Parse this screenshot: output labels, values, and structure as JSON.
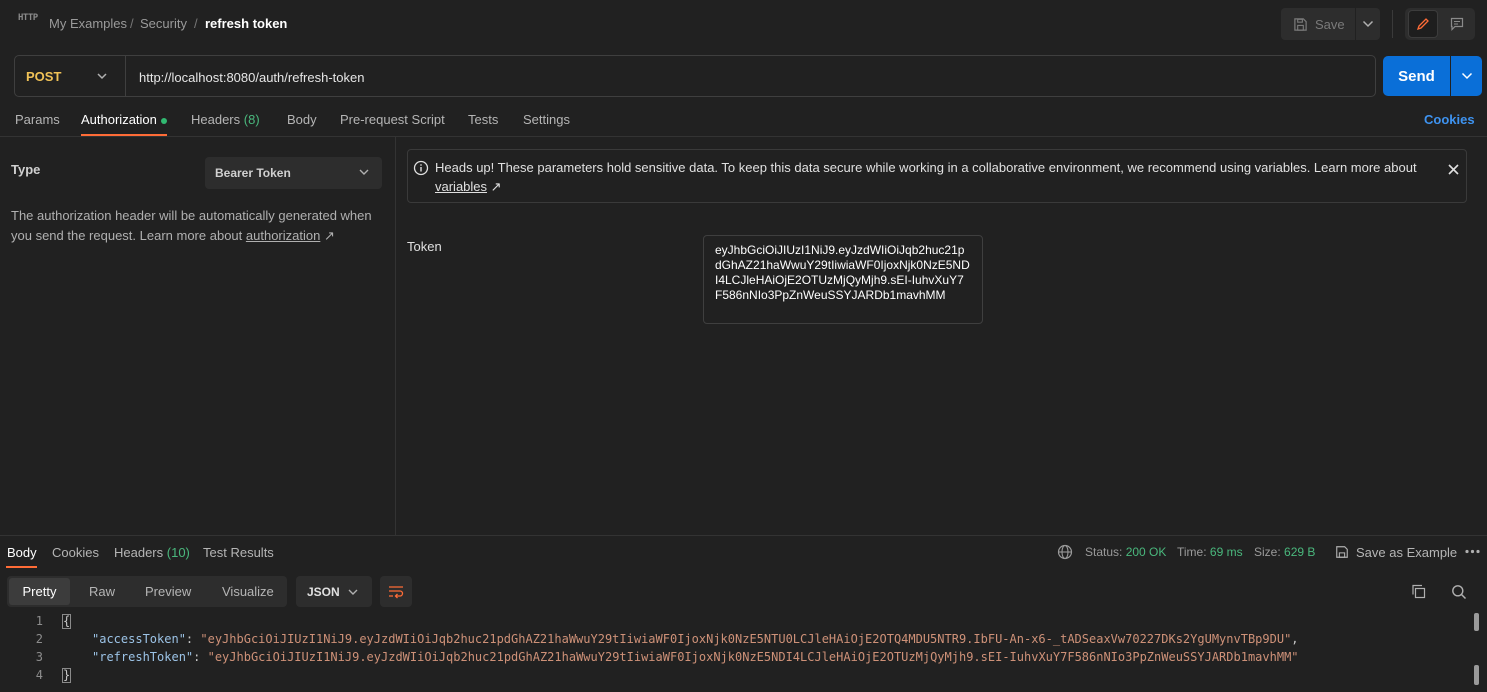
{
  "header": {
    "app_icon_text": "HTTP",
    "breadcrumb": [
      "My Examples",
      "Security",
      "refresh token"
    ],
    "breadcrumb_sep": "/",
    "save_label": "Save"
  },
  "request": {
    "method": "POST",
    "url": "http://localhost:8080/auth/refresh-token",
    "send_label": "Send",
    "tabs": [
      {
        "label": "Params"
      },
      {
        "label": "Authorization"
      },
      {
        "label": "Headers",
        "count": "(8)"
      },
      {
        "label": "Body"
      },
      {
        "label": "Pre-request Script"
      },
      {
        "label": "Tests"
      },
      {
        "label": "Settings"
      }
    ],
    "active_tab": "Authorization",
    "cookies_label": "Cookies"
  },
  "auth": {
    "type_label": "Type",
    "type_value": "Bearer Token",
    "description": "The authorization header will be automatically generated when you send the request. Learn more about ",
    "description_link": "authorization",
    "notice_text": "Heads up! These parameters hold sensitive data. To keep this data secure while working in a collaborative environment, we recommend using variables. Learn more about ",
    "notice_link": "variables",
    "token_label": "Token",
    "token_value": "eyJhbGciOiJIUzI1NiJ9.eyJzdWIiOiJqb2huc21pdGhAZ21haWwuY29tIiwiaWF0IjoxNjk0NzE5NDI4LCJleHAiOjE2OTUzMjQyMjh9.sEI-IuhvXuY7F586nNIo3PpZnWeuSSYJARDb1mavhMM"
  },
  "response": {
    "tabs": [
      {
        "label": "Body"
      },
      {
        "label": "Cookies"
      },
      {
        "label": "Headers",
        "count": "(10)"
      },
      {
        "label": "Test Results"
      }
    ],
    "status_label": "Status:",
    "status_value": "200 OK",
    "time_label": "Time:",
    "time_value": "69 ms",
    "size_label": "Size:",
    "size_value": "629 B",
    "save_example_label": "Save as Example",
    "views": [
      "Pretty",
      "Raw",
      "Preview",
      "Visualize"
    ],
    "format": "JSON",
    "line_numbers": [
      "1",
      "2",
      "3",
      "4"
    ],
    "json": {
      "open_brace": "{",
      "close_brace": "}",
      "access_key": "\"accessToken\"",
      "access_value": "\"eyJhbGciOiJIUzI1NiJ9.eyJzdWIiOiJqb2huc21pdGhAZ21haWwuY29tIiwiaWF0IjoxNjk0NzE5NTU0LCJleHAiOjE2OTQ4MDU5NTR9.IbFU-An-x6-_tADSeaxVw70227DKs2YgUMynvTBp9DU\"",
      "refresh_key": "\"refreshToken\"",
      "refresh_value": "\"eyJhbGciOiJIUzI1NiJ9.eyJzdWIiOiJqb2huc21pdGhAZ21haWwuY29tIiwiaWF0IjoxNjk0NzE5NDI4LCJleHAiOjE2OTUzMjQyMjh9.sEI-IuhvXuY7F586nNIo3PpZnWeuSSYJARDb1mavhMM\""
    }
  },
  "icons": [
    "http-app-icon",
    "save-icon",
    "chevron-down-icon",
    "pencil-icon",
    "comment-icon",
    "info-icon",
    "close-icon",
    "globe-icon",
    "save-icon",
    "more-icon",
    "wrap-icon",
    "copy-icon",
    "search-icon"
  ],
  "colors": {
    "accent_orange": "#ff6c37",
    "send_blue": "#0a6fd8",
    "method_yellow": "#f0c257",
    "status_green": "#4ab87d",
    "link_blue": "#3e93f0",
    "background": "#212121"
  }
}
